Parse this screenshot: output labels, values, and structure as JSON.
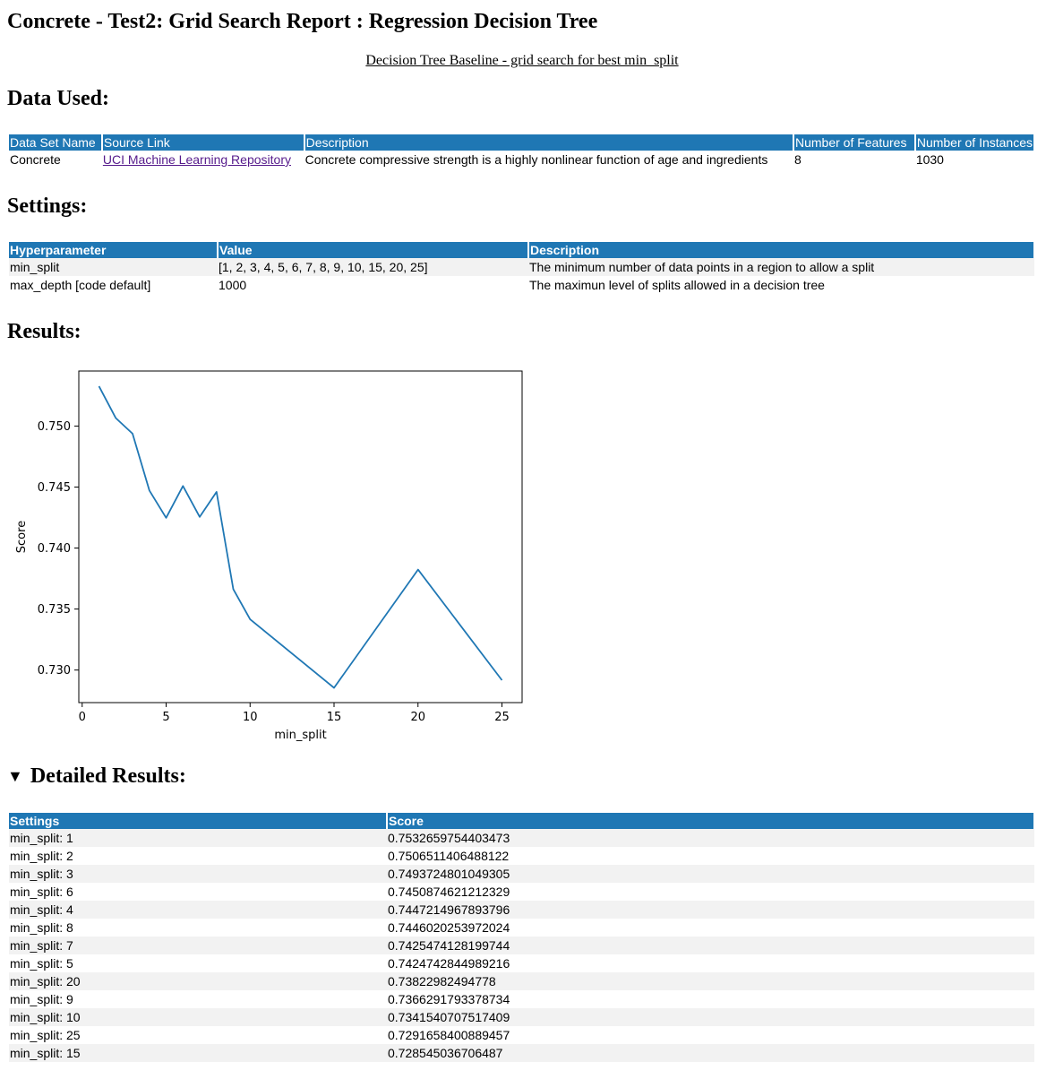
{
  "page": {
    "title": "Concrete - Test2: Grid Search Report : Regression Decision Tree",
    "subtitle": "Decision Tree Baseline - grid search for best min_split"
  },
  "data_used": {
    "heading": "Data Used:",
    "headers": [
      "Data Set Name",
      "Source Link",
      "Description",
      "Number of Features",
      "Number of Instances"
    ],
    "row": {
      "name": "Concrete",
      "link": "UCI Machine Learning Repository",
      "description": "Concrete compressive strength is a highly nonlinear function of age and ingredients",
      "features": "8",
      "instances": "1030"
    }
  },
  "settings": {
    "heading": "Settings:",
    "headers": [
      "Hyperparameter",
      "Value",
      "Description"
    ],
    "rows": [
      [
        "min_split",
        "[1, 2, 3, 4, 5, 6, 7, 8, 9, 10, 15, 20, 25]",
        "The minimum number of data points in a region to allow a split"
      ],
      [
        "max_depth [code default]",
        "1000",
        "The maximun level of splits allowed in a decision tree"
      ]
    ]
  },
  "results": {
    "heading": "Results:"
  },
  "chart_data": {
    "type": "line",
    "xlabel": "min_split",
    "ylabel": "Score",
    "x": [
      1,
      2,
      3,
      4,
      5,
      6,
      7,
      8,
      9,
      10,
      15,
      20,
      25
    ],
    "series": [
      {
        "values": [
          0.7532659754403473,
          0.7506511406488122,
          0.7493724801049305,
          0.7447214967893796,
          0.7424742844989216,
          0.7450874621212329,
          0.7425474128199744,
          0.7446020253972024,
          0.7366291793378734,
          0.7341540707517409,
          0.728545036706487,
          0.73822982494778,
          0.7291658400889457
        ],
        "color": "#1f77b4"
      }
    ],
    "xticks": [
      0,
      5,
      10,
      15,
      20,
      25
    ],
    "yticks": [
      0.73,
      0.735,
      0.74,
      0.745,
      0.75
    ],
    "ytick_labels": [
      "0.730",
      "0.735",
      "0.740",
      "0.745",
      "0.750"
    ],
    "xlim": [
      -0.2,
      26.2
    ],
    "ylim": [
      0.72733,
      0.75451
    ],
    "grid": false
  },
  "detailed": {
    "heading": "Detailed Results:",
    "headers": [
      "Settings",
      "Score"
    ],
    "rows": [
      [
        "min_split: 1",
        "0.7532659754403473"
      ],
      [
        "min_split: 2",
        "0.7506511406488122"
      ],
      [
        "min_split: 3",
        "0.7493724801049305"
      ],
      [
        "min_split: 6",
        "0.7450874621212329"
      ],
      [
        "min_split: 4",
        "0.7447214967893796"
      ],
      [
        "min_split: 8",
        "0.7446020253972024"
      ],
      [
        "min_split: 7",
        "0.7425474128199744"
      ],
      [
        "min_split: 5",
        "0.7424742844989216"
      ],
      [
        "min_split: 20",
        "0.73822982494778"
      ],
      [
        "min_split: 9",
        "0.7366291793378734"
      ],
      [
        "min_split: 10",
        "0.7341540707517409"
      ],
      [
        "min_split: 25",
        "0.7291658400889457"
      ],
      [
        "min_split: 15",
        "0.728545036706487"
      ]
    ]
  },
  "colors": {
    "header_bg": "#1f77b4",
    "stripe": "#f2f2f2",
    "link": "#551a8b"
  },
  "icons": {
    "details_toggle": "triangle-down-icon"
  }
}
